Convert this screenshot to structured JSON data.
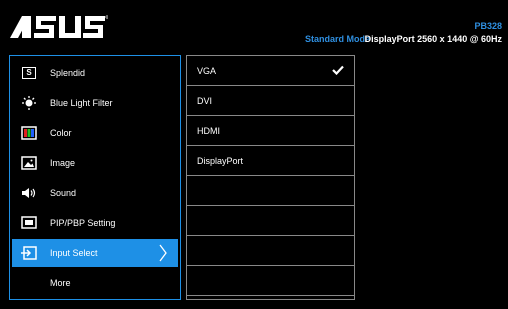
{
  "header": {
    "logo": "ASUS",
    "model": "PB328",
    "mode": "Standard Mode",
    "signal": "DisplayPort 2560 x 1440 @ 60Hz"
  },
  "menu": {
    "items": [
      {
        "label": "Splendid",
        "icon": "splendid-icon"
      },
      {
        "label": "Blue Light Filter",
        "icon": "blue-light-filter-icon"
      },
      {
        "label": "Color",
        "icon": "color-icon"
      },
      {
        "label": "Image",
        "icon": "image-icon"
      },
      {
        "label": "Sound",
        "icon": "speaker-icon"
      },
      {
        "label": "PIP/PBP Setting",
        "icon": "pip-icon"
      },
      {
        "label": "Input Select",
        "icon": "input-select-icon",
        "selected": true
      },
      {
        "label": "More",
        "icon": ""
      }
    ],
    "splendid_glyph": "S"
  },
  "inputs": {
    "options": [
      "VGA",
      "DVI",
      "HDMI",
      "DisplayPort"
    ],
    "checked": "VGA",
    "row_count": 8
  },
  "colors": {
    "accent": "#1e90e6",
    "model_text": "#2f8fe0",
    "background": "#000000",
    "divider": "#888888"
  }
}
